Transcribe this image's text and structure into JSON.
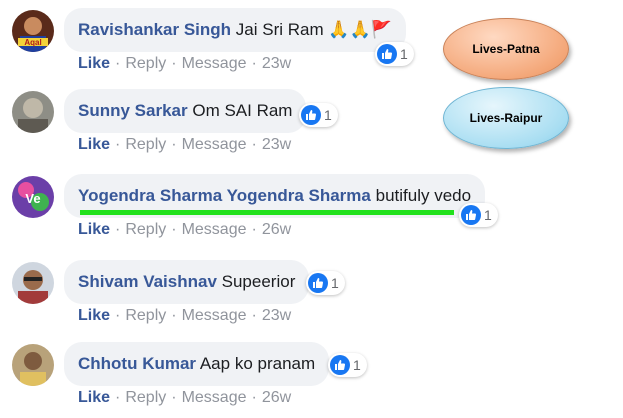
{
  "comments": [
    {
      "author": "Ravishankar Singh",
      "text": "Jai Sri Ram",
      "like_count": "1",
      "like_label": "Like",
      "reply_label": "Reply",
      "message_label": "Message",
      "time": "23w"
    },
    {
      "author": "Sunny Sarkar",
      "text": "Om SAI Ram",
      "like_count": "1",
      "like_label": "Like",
      "reply_label": "Reply",
      "message_label": "Message",
      "time": "23w"
    },
    {
      "author": "Yogendra Sharma Yogendra Sharma",
      "text": "butifuly vedo",
      "like_count": "1",
      "like_label": "Like",
      "reply_label": "Reply",
      "message_label": "Message",
      "time": "26w"
    },
    {
      "author": "Shivam Vaishnav",
      "text": "Supeerior",
      "like_count": "1",
      "like_label": "Like",
      "reply_label": "Reply",
      "message_label": "Message",
      "time": "23w"
    },
    {
      "author": "Chhotu Kumar",
      "text": "Aap ko pranam",
      "like_count": "1",
      "like_label": "Like",
      "reply_label": "Reply",
      "message_label": "Message",
      "time": "26w"
    }
  ],
  "avatar_labels": {
    "first": "Aqal",
    "third": "Ve"
  },
  "callouts": {
    "patna": "Lives-Patna",
    "raipur": "Lives-Raipur"
  },
  "colors": {
    "author": "#385898",
    "bubble": "#f0f2f5",
    "like_blue": "#1877f2",
    "highlight": "#22e11c"
  },
  "icons": [
    "folded-hands-emoji",
    "red-flag-emoji",
    "thumbs-up-reaction"
  ]
}
